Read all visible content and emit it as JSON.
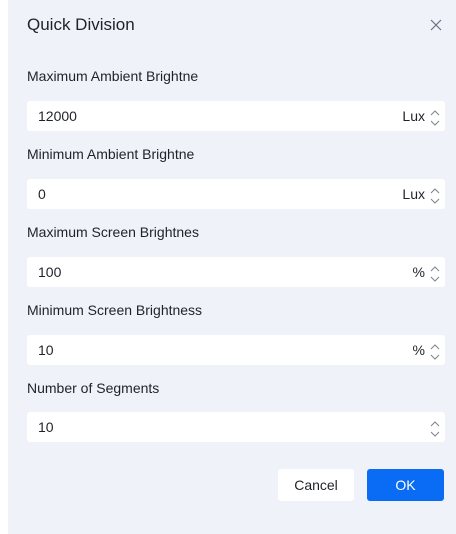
{
  "dialog": {
    "title": "Quick Division",
    "close_icon": "close-icon"
  },
  "fields": [
    {
      "label": "Maximum Ambient Brightne",
      "value": "12000",
      "unit": "Lux"
    },
    {
      "label": "Minimum Ambient Brightne",
      "value": "0",
      "unit": "Lux"
    },
    {
      "label": "Maximum Screen Brightnes",
      "value": "100",
      "unit": "%"
    },
    {
      "label": "Minimum Screen Brightness",
      "value": "10",
      "unit": "%"
    },
    {
      "label": "Number of Segments",
      "value": "10",
      "unit": ""
    }
  ],
  "buttons": {
    "cancel_label": "Cancel",
    "ok_label": "OK"
  },
  "colors": {
    "dialog_background": "#eff2f9",
    "input_background": "#ffffff",
    "primary": "#0a6cf5",
    "text": "#1f2329"
  }
}
